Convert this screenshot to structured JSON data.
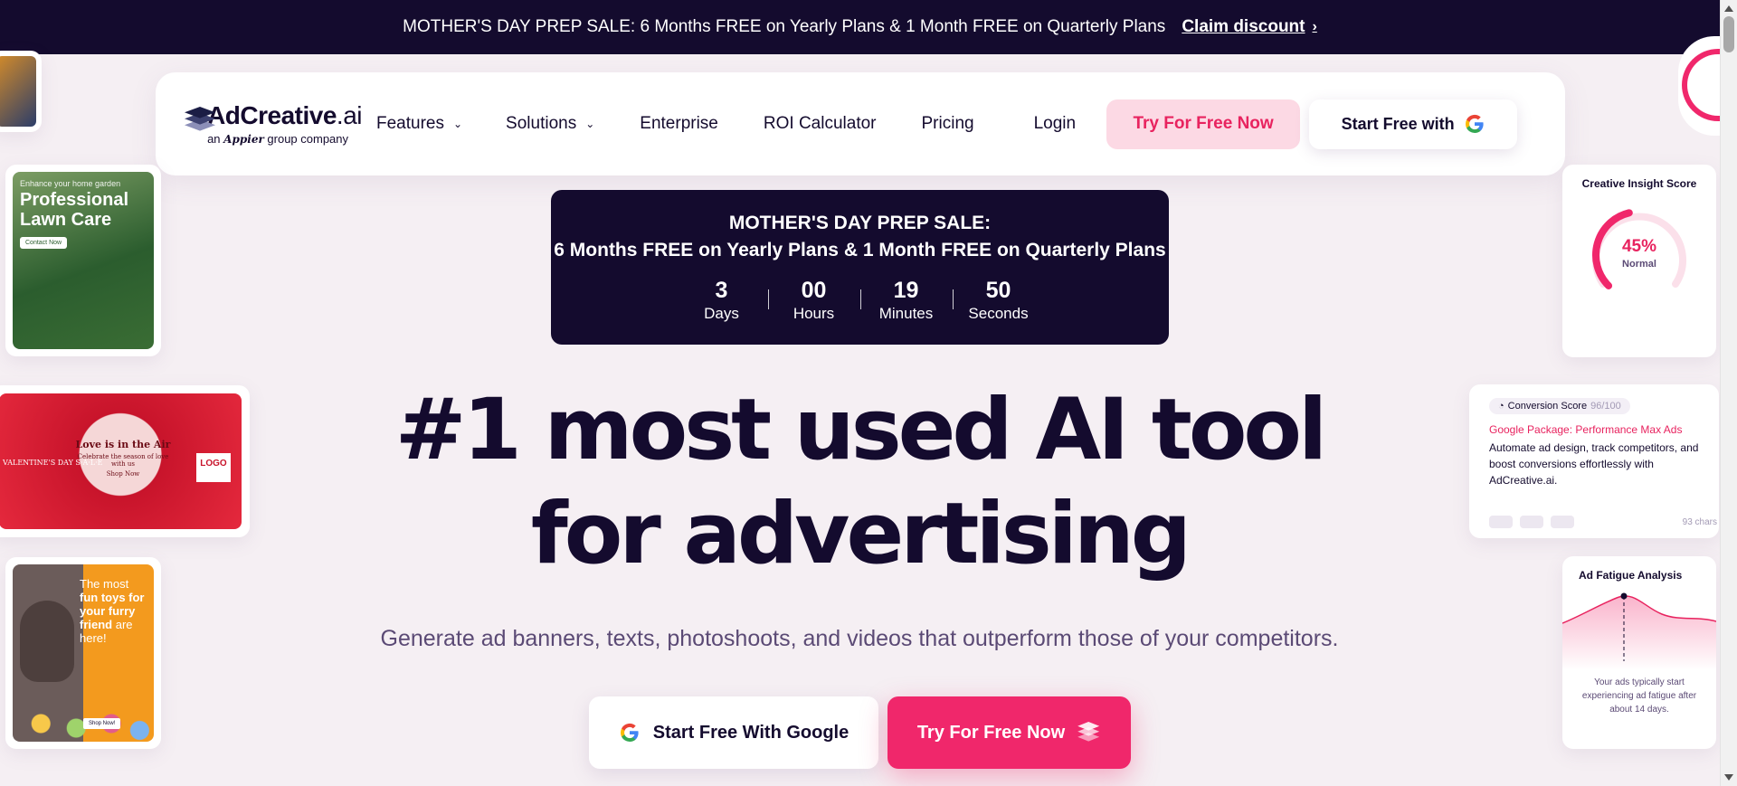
{
  "topbar": {
    "message": "MOTHER'S DAY PREP SALE: 6 Months FREE on Yearly Plans & 1 Month FREE on Quarterly Plans",
    "claim_label": "Claim discount",
    "claim_icon": "chevron-right-icon"
  },
  "nav": {
    "logo_brand": "AdCreative",
    "logo_ai": ".ai",
    "logo_sub_prefix": "an",
    "logo_sub_company": "Appier",
    "logo_sub_suffix": "group company",
    "items": [
      {
        "label": "Features",
        "has_dropdown": true
      },
      {
        "label": "Solutions",
        "has_dropdown": true
      },
      {
        "label": "Enterprise",
        "has_dropdown": false
      },
      {
        "label": "ROI Calculator",
        "has_dropdown": false
      },
      {
        "label": "Pricing",
        "has_dropdown": false
      },
      {
        "label": "Login",
        "has_dropdown": false
      }
    ],
    "try_label": "Try For Free Now",
    "google_label": "Start Free with"
  },
  "promo": {
    "line1": "MOTHER'S DAY PREP SALE:",
    "line2": "6 Months FREE on Yearly Plans & 1 Month FREE on Quarterly Plans",
    "countdown": [
      {
        "value": "3",
        "unit": "Days"
      },
      {
        "value": "00",
        "unit": "Hours"
      },
      {
        "value": "19",
        "unit": "Minutes"
      },
      {
        "value": "50",
        "unit": "Seconds"
      }
    ]
  },
  "hero": {
    "headline_line1": "#1 most used AI tool",
    "headline_line2": "for advertising",
    "subline": "Generate ad banners, texts, photoshoots, and videos that outperform those of your competitors.",
    "cta_google": "Start Free With Google",
    "cta_try": "Try For Free Now"
  },
  "ads": {
    "lawn_small": "Enhance your home garden",
    "lawn_big": "Professional Lawn Care",
    "lawn_button": "Contact Now",
    "valentine_title": "Love is in the Air",
    "valentine_sub": "Celebrate the season of love with us",
    "valentine_button": "Shop Now",
    "valentine_side": "VALENTINE'S DAY S·A·L·E",
    "valentine_logo": "LOGO",
    "dog_text_1": "The most",
    "dog_text_2": "fun toys for your furry friend",
    "dog_text_3": "are here!",
    "dog_button": "Shop Now!"
  },
  "widgets": {
    "insight_title": "Creative Insight Score",
    "insight_pct": "45%",
    "insight_level": "Normal",
    "insight_value": 0.45,
    "conv_badge": "Conversion Score",
    "conv_score": "96/100",
    "conv_title": "Google Package: Performance Max Ads",
    "conv_desc": "Automate ad design, track competitors, and boost conversions effortlessly with AdCreative.ai.",
    "conv_chars": "93 chars",
    "fatigue_title": "Ad Fatigue Analysis",
    "fatigue_desc": "Your ads typically start experiencing ad fatigue after about 14 days."
  },
  "colors": {
    "brand_dark": "#140b2e",
    "accent_pink": "#f0276b",
    "background": "#f5eff3"
  }
}
